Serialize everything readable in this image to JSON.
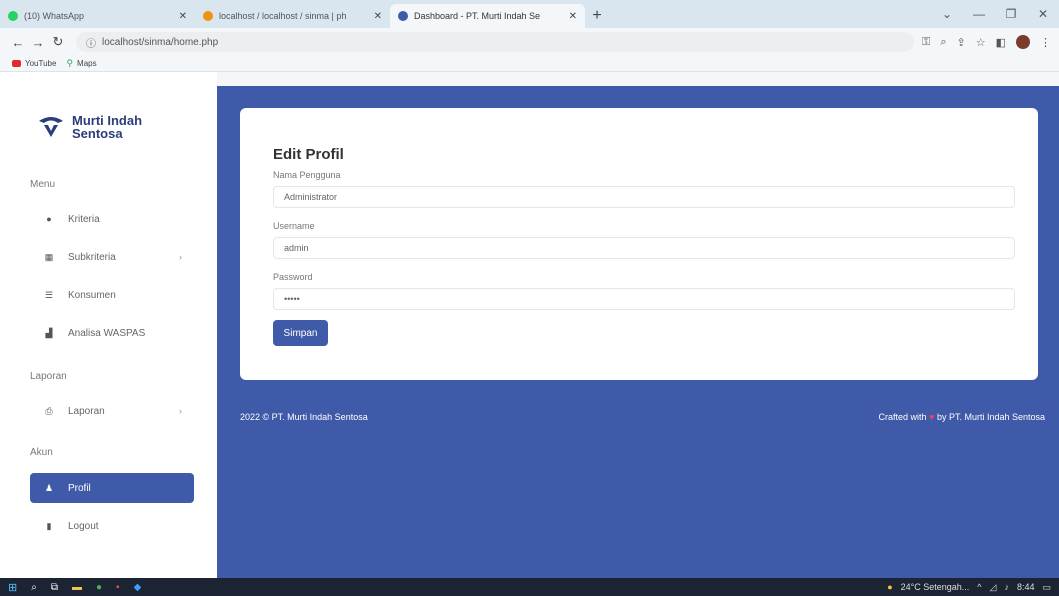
{
  "browser": {
    "tabs": [
      {
        "title": "(10) WhatsApp",
        "favicon_color": "#25d366",
        "active": false
      },
      {
        "title": "localhost / localhost / sinma | ph",
        "favicon_color": "#f29111",
        "active": false
      },
      {
        "title": "Dashboard - PT. Murti Indah Se",
        "favicon_color": "#3f5aa8",
        "active": true
      }
    ],
    "new_tab": "+",
    "url": "localhost/sinma/home.php",
    "bookmarks": [
      {
        "label": "YouTube",
        "icon": "youtube-icon"
      },
      {
        "label": "Maps",
        "icon": "map-pin-icon"
      }
    ]
  },
  "brand": {
    "line1": "Murti Indah",
    "line2": "Sentosa"
  },
  "sidebar": {
    "menu_heading": "Menu",
    "items": [
      {
        "label": "Kriteria",
        "icon": "circle-icon",
        "chevron": false
      },
      {
        "label": "Subkriteria",
        "icon": "grid-icon",
        "chevron": true
      },
      {
        "label": "Konsumen",
        "icon": "users-icon",
        "chevron": false
      },
      {
        "label": "Analisa WASPAS",
        "icon": "chart-icon",
        "chevron": false
      }
    ],
    "report_heading": "Laporan",
    "report_items": [
      {
        "label": "Laporan",
        "icon": "print-icon",
        "chevron": true
      }
    ],
    "account_heading": "Akun",
    "account_items": [
      {
        "label": "Profil",
        "icon": "user-icon",
        "active": true
      },
      {
        "label": "Logout",
        "icon": "logout-icon",
        "active": false
      }
    ]
  },
  "form": {
    "title": "Edit Profil",
    "fields": [
      {
        "label": "Nama Pengguna",
        "value": "Administrator"
      },
      {
        "label": "Username",
        "value": "admin"
      },
      {
        "label": "Password",
        "value": "•••••"
      }
    ],
    "submit_label": "Simpan"
  },
  "footer": {
    "left": "2022 © PT. Murti Indah Sentosa",
    "right_before": "Crafted with",
    "heart": "♥",
    "right_after": "by PT. Murti Indah Sentosa"
  },
  "taskbar": {
    "weather": "24°C Setengah...",
    "clock": "8:44"
  },
  "colors": {
    "primary": "#3f5aa8",
    "brand_text": "#2b3e7a"
  }
}
